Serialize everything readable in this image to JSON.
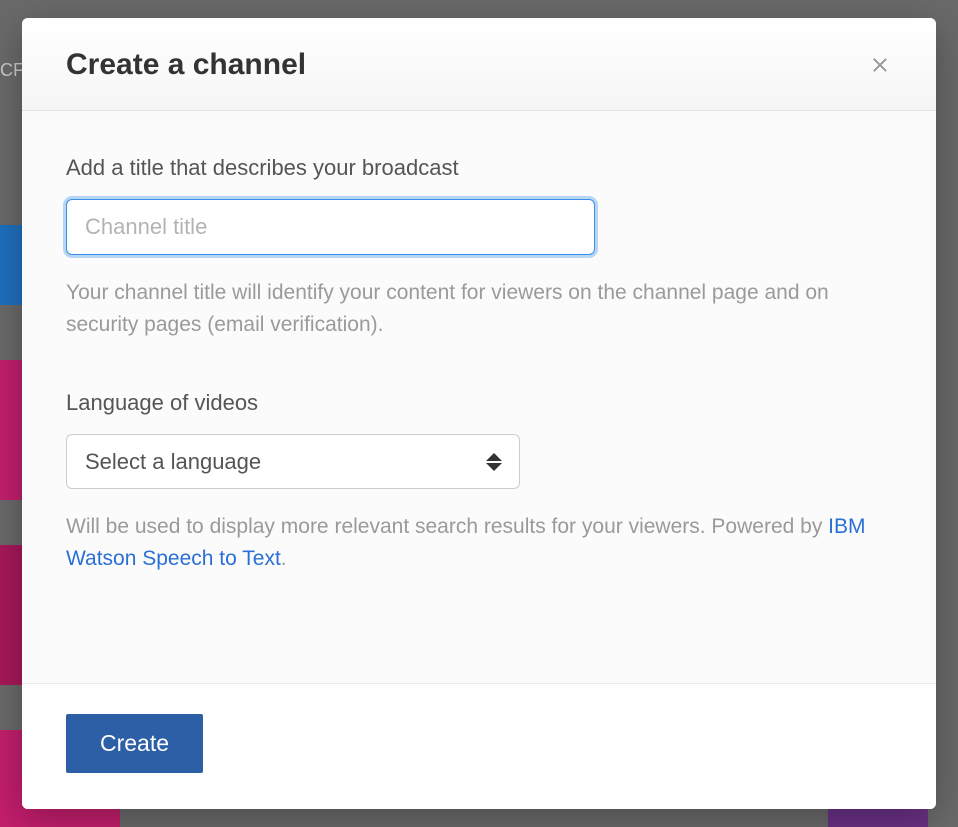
{
  "modal": {
    "title": "Create a channel",
    "title_field": {
      "label": "Add a title that describes your broadcast",
      "placeholder": "Channel title",
      "value": "",
      "help": "Your channel title will identify your content for viewers on the channel page and on security pages (email verification)."
    },
    "language_field": {
      "label": "Language of videos",
      "selected": "Select a language",
      "help_prefix": "Will be used to display more relevant search results for your viewers. Powered by ",
      "help_link_text": "IBM Watson Speech to Text",
      "help_suffix": "."
    },
    "footer": {
      "create_label": "Create"
    }
  },
  "background": {
    "text_fragment": "CF"
  }
}
